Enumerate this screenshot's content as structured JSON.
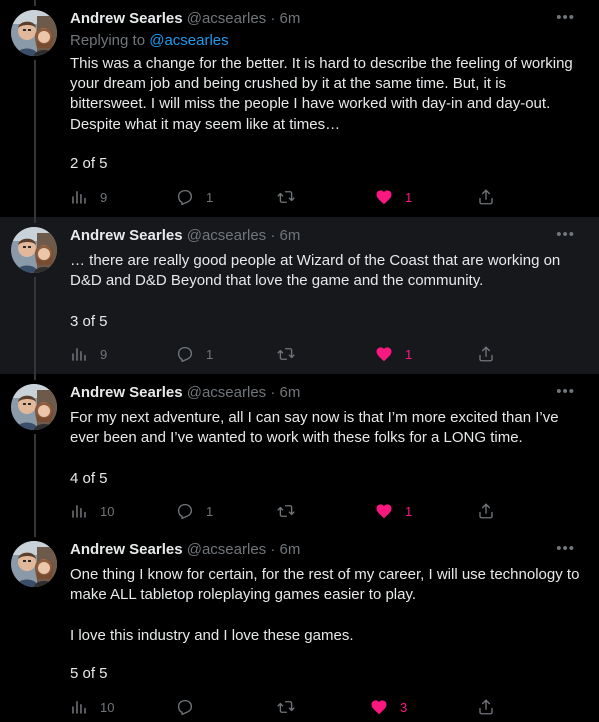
{
  "tweets": [
    {
      "name": "Andrew Searles",
      "handle": "@acsearles",
      "dot": "·",
      "time": "6m",
      "replying_prefix": "Replying to",
      "replying_to": "@acsearles",
      "text": "This was a change for the better. It is hard to describe the feeling of working your dream job and being crushed by it at the same time. But, it is bittersweet. I will miss the people I have worked with day-in and day-out. Despite what it may seem like at times…",
      "count": "2 of 5",
      "views": "9",
      "replies": "1",
      "retweets": "",
      "likes": "1",
      "liked": true
    },
    {
      "name": "Andrew Searles",
      "handle": "@acsearles",
      "dot": "·",
      "time": "6m",
      "text": "… there are really good people at Wizard of the Coast that are working on D&D and D&D Beyond that love the game and the community.",
      "count": "3 of 5",
      "views": "9",
      "replies": "1",
      "retweets": "",
      "likes": "1",
      "liked": true
    },
    {
      "name": "Andrew Searles",
      "handle": "@acsearles",
      "dot": "·",
      "time": "6m",
      "text": "For my next adventure, all I can say now is that I’m more excited than I’ve ever been and I’ve wanted to work with these folks for a LONG time.",
      "count": "4 of 5",
      "views": "10",
      "replies": "1",
      "retweets": "",
      "likes": "1",
      "liked": true
    },
    {
      "name": "Andrew Searles",
      "handle": "@acsearles",
      "dot": "·",
      "time": "6m",
      "text": "One thing I know for certain, for the rest of my career, I will use technology to make ALL tabletop roleplaying games easier to play.\n\nI love this industry and I love these games.",
      "count": "5 of 5",
      "views": "10",
      "replies": "",
      "retweets": "",
      "likes": "3",
      "liked": true
    }
  ],
  "icons": {
    "more": "more-horizontal-icon",
    "views": "analytics-icon",
    "reply": "reply-icon",
    "retweet": "retweet-icon",
    "like": "heart-icon",
    "share": "share-icon"
  },
  "colors": {
    "background": "#000000",
    "hover_background": "#16181c",
    "text": "#e7e9ea",
    "secondary": "#71767b",
    "link": "#1d9bf0",
    "like": "#f91880",
    "thread_line": "#333639"
  }
}
